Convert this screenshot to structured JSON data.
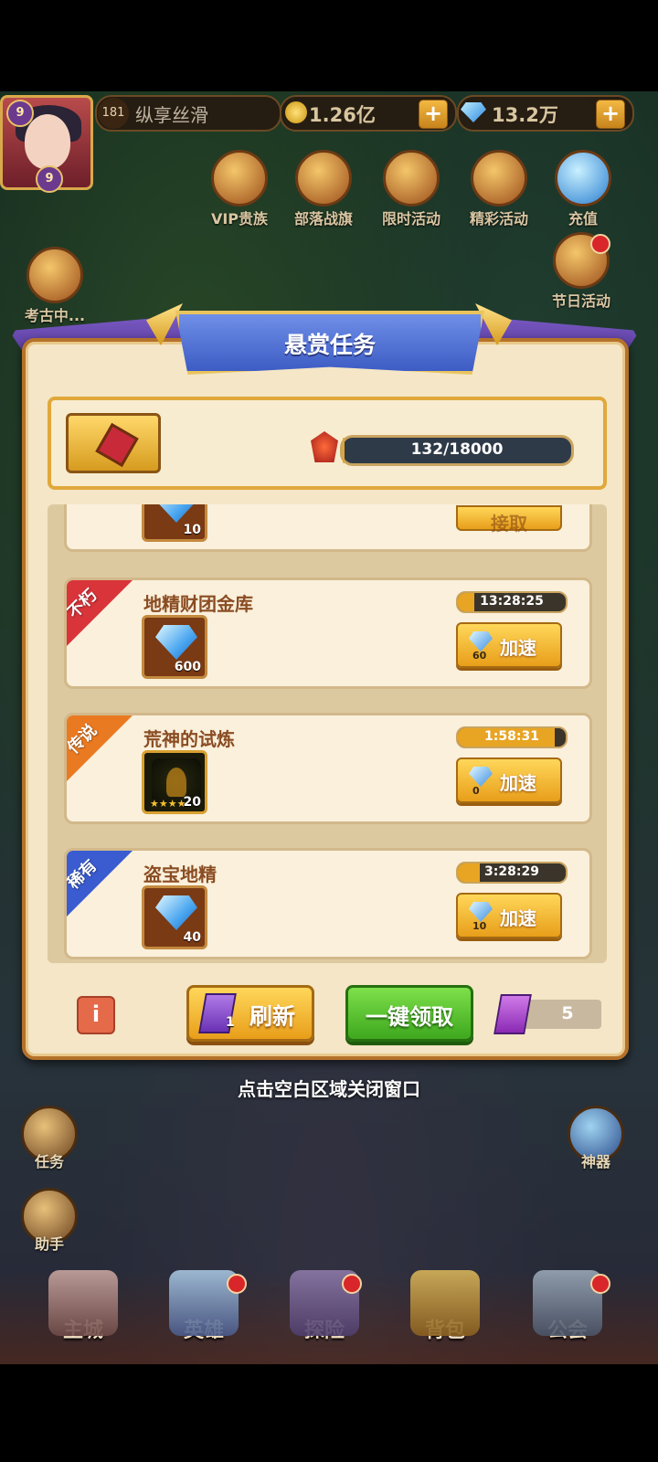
{
  "player": {
    "level": "181",
    "name": "纵享丝滑",
    "avatar_level_top": "9",
    "avatar_level_bottom": "9"
  },
  "resources": {
    "gold": "1.26亿",
    "diamond": "13.2万",
    "plus_label": "+"
  },
  "top_icons": [
    {
      "label": "VIP贵族",
      "icon": "crown-icon"
    },
    {
      "label": "部落战旗",
      "icon": "banner-icon"
    },
    {
      "label": "限时活动",
      "icon": "compass-icon"
    },
    {
      "label": "精彩活动",
      "icon": "drum-icon"
    },
    {
      "label": "充值",
      "icon": "diamond-icon"
    },
    {
      "label": "节日活动",
      "icon": "chest-icon"
    },
    {
      "label": "考古中...",
      "icon": "treasure-icon"
    }
  ],
  "side_icons": [
    {
      "label": "任务",
      "icon": "scroll-icon"
    },
    {
      "label": "助手",
      "icon": "gift-icon"
    },
    {
      "label": "神器",
      "icon": "artifact-icon"
    }
  ],
  "bottom_nav": [
    {
      "label": "主城",
      "icon": "castle-icon"
    },
    {
      "label": "英雄",
      "icon": "hero-icon"
    },
    {
      "label": "探险",
      "icon": "portal-icon"
    },
    {
      "label": "背包",
      "icon": "backpack-icon"
    },
    {
      "label": "公会",
      "icon": "guild-tower-icon"
    }
  ],
  "dialog": {
    "title": "悬赏任务",
    "progress_text": "132/18000",
    "progress_value": 132,
    "progress_max": 18000,
    "partial_row": {
      "reward_qty": "10",
      "button_label": "接取"
    },
    "quests": [
      {
        "rarity": "不朽",
        "rarity_color": "#d8343a",
        "title": "地精财团金库",
        "reward_type": "diamond",
        "reward_qty": "600",
        "timer": "13:28:25",
        "timer_fill": 0.15,
        "speed_cost": "60",
        "speed_label": "加速"
      },
      {
        "rarity": "传说",
        "rarity_color": "#ea7a22",
        "title": "荒神的试炼",
        "reward_type": "hero-shard",
        "reward_stars": "★★★★",
        "reward_qty": "20",
        "timer": "1:58:31",
        "timer_fill": 0.9,
        "speed_cost": "0",
        "speed_label": "加速"
      },
      {
        "rarity": "稀有",
        "rarity_color": "#3a5cd0",
        "title": "盗宝地精",
        "reward_type": "diamond",
        "reward_qty": "40",
        "timer": "3:28:29",
        "timer_fill": 0.2,
        "speed_cost": "10",
        "speed_label": "加速"
      }
    ],
    "info_button": "i",
    "refresh_label": "刷新",
    "refresh_card_count": "1",
    "claim_all_label": "一键领取",
    "refresh_cards_owned": "5"
  },
  "close_hint": "点击空白区域关闭窗口",
  "colors": {
    "panel_bg": "#f4e6c6",
    "banner": "#4d6ed6",
    "claim_green": "#3ea81e",
    "gold_button": "#e89e1a"
  }
}
